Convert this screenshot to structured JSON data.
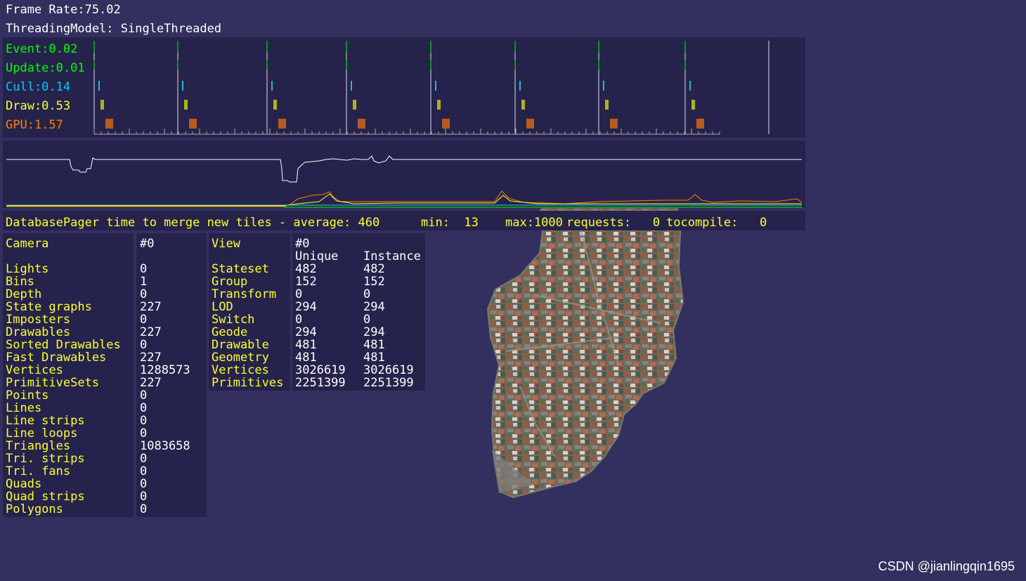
{
  "header": {
    "frame_rate": "Frame Rate:75.02",
    "threading_model": "ThreadingModel: SingleThreaded"
  },
  "timing": {
    "rows": [
      {
        "label": "Event:0.02",
        "color": "#00ff00"
      },
      {
        "label": "Update:0.01",
        "color": "#00ff00"
      },
      {
        "label": "Cull:0.14",
        "color": "#00ccff"
      },
      {
        "label": "Draw:0.53",
        "color": "#ffff33"
      },
      {
        "label": "GPU:1.57",
        "color": "#ff8000"
      }
    ]
  },
  "pager": {
    "average": "DatabasePager time to merge new tiles - average: 460",
    "min": "min:  13",
    "max": "max:1000",
    "requests": "requests:   0",
    "tocompile": "tocompile:   0"
  },
  "camera_stats": {
    "title_label": "Camera",
    "title_value": "#0",
    "rows": [
      {
        "label": "Lights",
        "value": "0"
      },
      {
        "label": "Bins",
        "value": "1"
      },
      {
        "label": "Depth",
        "value": "0"
      },
      {
        "label": "State graphs",
        "value": "227"
      },
      {
        "label": "Imposters",
        "value": "0"
      },
      {
        "label": "Drawables",
        "value": "227"
      },
      {
        "label": "Sorted Drawables",
        "value": "0"
      },
      {
        "label": "Fast Drawables",
        "value": "227"
      },
      {
        "label": "Vertices",
        "value": "1288573"
      },
      {
        "label": "PrimitiveSets",
        "value": "227"
      },
      {
        "label": "Points",
        "value": "0"
      },
      {
        "label": "Lines",
        "value": "0"
      },
      {
        "label": "Line strips",
        "value": "0"
      },
      {
        "label": "Line loops",
        "value": "0"
      },
      {
        "label": "Triangles",
        "value": "1083658"
      },
      {
        "label": "Tri. strips",
        "value": "0"
      },
      {
        "label": "Tri. fans",
        "value": "0"
      },
      {
        "label": "Quads",
        "value": "0"
      },
      {
        "label": "Quad strips",
        "value": "0"
      },
      {
        "label": "Polygons",
        "value": "0"
      }
    ]
  },
  "view_stats": {
    "title_label": "View",
    "title_value": "#0",
    "col_unique": "Unique",
    "col_instance": "Instance",
    "rows": [
      {
        "label": "Stateset",
        "unique": "482",
        "instance": "482"
      },
      {
        "label": "Group",
        "unique": "152",
        "instance": "152"
      },
      {
        "label": "Transform",
        "unique": "0",
        "instance": "0"
      },
      {
        "label": "LOD",
        "unique": "294",
        "instance": "294"
      },
      {
        "label": "Switch",
        "unique": "0",
        "instance": "0"
      },
      {
        "label": "Geode",
        "unique": "294",
        "instance": "294"
      },
      {
        "label": "Drawable",
        "unique": "481",
        "instance": "481"
      },
      {
        "label": "Geometry",
        "unique": "481",
        "instance": "481"
      },
      {
        "label": "Vertices",
        "unique": "3026619",
        "instance": "3026619"
      },
      {
        "label": "Primitives",
        "unique": "2251399",
        "instance": "2251399"
      }
    ]
  },
  "watermark": "CSDN @jianlingqin1695",
  "colors": {
    "background": "#33305f",
    "panel": "#25234b",
    "stat_label": "#ffff33",
    "gpu_bar": "#b85a20",
    "draw_bar": "#b0b020",
    "cull_bar": "#22b8dd"
  }
}
